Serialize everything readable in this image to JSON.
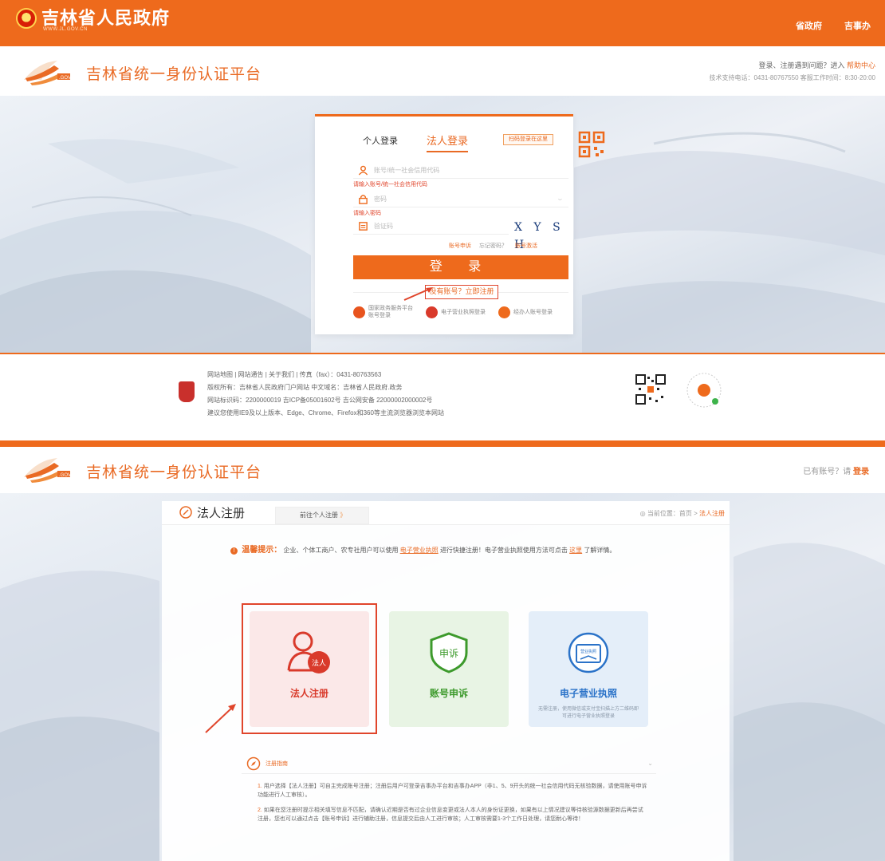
{
  "topbar": {
    "gov_name": "吉林省人民政府",
    "gov_domain": "WWW.JL.GOV.CN",
    "nav": [
      "省政府",
      "吉事办"
    ]
  },
  "header1": {
    "platform_title": "吉林省统一身份认证平台",
    "help_prefix": "登录、注册遇到问题？进入",
    "help_link": "帮助中心",
    "support": "技术支持电话：0431-80767550  客服工作时间：8:30-20:00"
  },
  "login": {
    "tab_personal": "个人登录",
    "tab_legal": "法人登录",
    "scan_tip": "扫码登录在这里",
    "account_placeholder": "账号/统一社会信用代码",
    "account_error": "请输入账号/统一社会信用代码",
    "password_placeholder": "密码",
    "password_error": "请输入密码",
    "captcha_placeholder": "验证码",
    "captcha_text": "X Y S H",
    "link_appeal": "账号申诉",
    "link_forgot": "忘记密码？",
    "link_activate": "账号激活",
    "login_button": "登 录",
    "register_link": "没有账号？立即注册",
    "alt_logins": [
      {
        "label": "国家政务服务平台账号登录",
        "color": "#e8541e"
      },
      {
        "label": "电子营业执照登录",
        "color": "#d93a2b"
      },
      {
        "label": "经办人账号登录",
        "color": "#ee6a1c"
      }
    ]
  },
  "footer": {
    "line1": "网站地图  |  网站通告  |  关于我们  |  传真（fax）：0431-80763563",
    "line2": "版权所有：吉林省人民政府门户网站    中文域名：吉林省人民政府.政务",
    "line3": "网站标识码：2200000019  吉ICP备05001602号  吉公网安备 22000002000002号",
    "line4": "建议您使用IE9及以上版本、Edge、Chrome、Firefox和360等主流浏览器浏览本网站"
  },
  "header2": {
    "platform_title": "吉林省统一身份认证平台",
    "have_account": "已有账号？请",
    "login_link": "登录"
  },
  "register": {
    "title": "法人注册",
    "goto_personal": "前往个人注册",
    "goto_arrow": "》",
    "crumb_prefix": "当前位置：首页 > ",
    "crumb_current": "法人注册",
    "tip_label": "温馨提示：",
    "tip_text1": "企业、个体工商户、农专社用户可以使用",
    "tip_link1": "电子营业执照",
    "tip_text2": "进行快捷注册！电子营业执照使用方法可点击",
    "tip_link2": "这里",
    "tip_text3": "了解详情。",
    "cards": {
      "legal": {
        "label": "法人注册",
        "badge": "法人"
      },
      "appeal": {
        "label": "账号申诉",
        "badge": "申诉"
      },
      "license": {
        "label": "电子营业执照",
        "badge": "营业执照",
        "desc": "无需注册，使用微信或支付宝扫描上方二维码即可进行电子营业执照登录"
      }
    },
    "guide": {
      "title": "注册指南",
      "chevron": "⌄",
      "item1": "用户选择【法人注册】可自主完成账号注册；注册后用户可登录吉事办平台和吉事办APP（非1、5、9开头的统一社会信用代码无核验数据，请使用账号申诉功能进行人工审核）。",
      "item2": "如果在您注册时提示相关填写信息不匹配，请确认近期是否有过企业信息变更或法人本人的身份证更换，如果有以上情况建议等待核验源数据更新后再尝试注册，您也可以通过点击【账号申诉】进行辅助注册，信息提交后由人工进行审核；人工审核需要1-3个工作日处理，请您耐心等待！"
    }
  },
  "colors": {
    "brand_orange": "#ee6a1c",
    "highlight_red": "#e0452b",
    "legal_card": "#fbe8e8",
    "appeal_card": "#e8f4e4",
    "license_card": "#e4eef9"
  }
}
